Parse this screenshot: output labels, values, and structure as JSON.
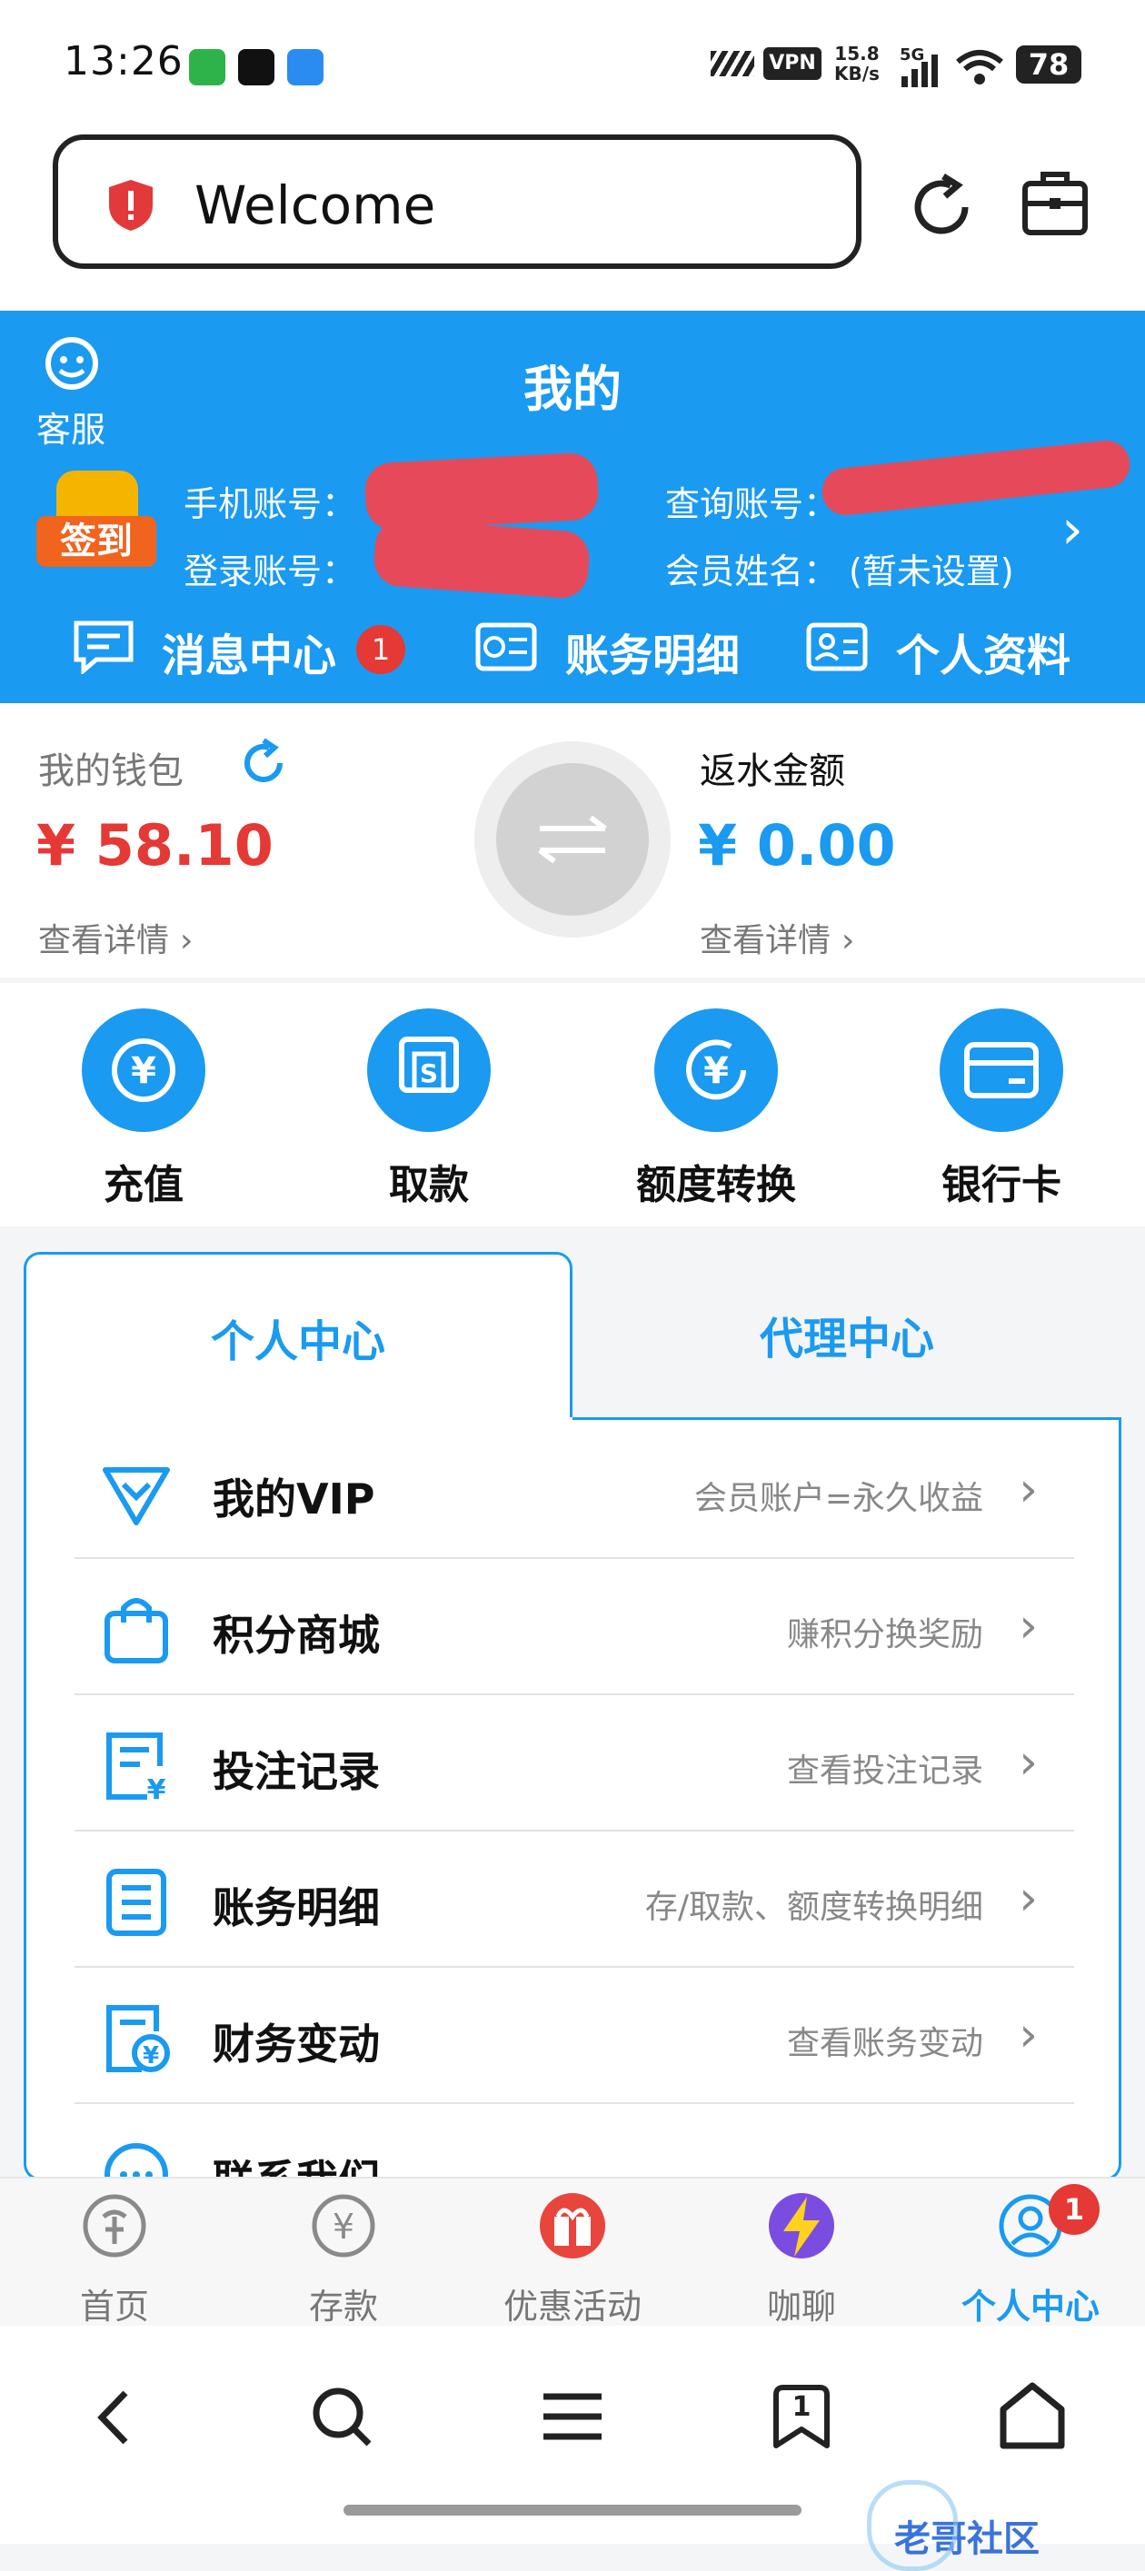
{
  "status_bar": {
    "time": "13:26",
    "vpn": "VPN",
    "speed_value": "15.8",
    "speed_unit": "KB/s",
    "network": "5G",
    "battery": "78"
  },
  "browser": {
    "url_text": "Welcome"
  },
  "header": {
    "title": "我的",
    "service_label": "客服",
    "signin_label": "签到",
    "phone_label": "手机账号：",
    "login_label": "登录账号：",
    "query_label": "查询账号：",
    "member_label": "会员姓名：",
    "member_value": "(暂未设置)",
    "quicklinks": [
      {
        "label": "消息中心",
        "badge": "1"
      },
      {
        "label": "账务明细"
      },
      {
        "label": "个人资料"
      }
    ]
  },
  "wallet": {
    "left_label": "我的钱包",
    "left_amount": "¥ 58.10",
    "right_label": "返水金额",
    "right_amount": "¥ 0.00",
    "detail_label": "查看详情",
    "chev": "›"
  },
  "actions": [
    {
      "label": "充值"
    },
    {
      "label": "取款"
    },
    {
      "label": "额度转换"
    },
    {
      "label": "银行卡"
    }
  ],
  "tabs": {
    "personal": "个人中心",
    "agent": "代理中心"
  },
  "menu": [
    {
      "title": "我的VIP",
      "sub": "会员账户=永久收益"
    },
    {
      "title": "积分商城",
      "sub": "赚积分换奖励"
    },
    {
      "title": "投注记录",
      "sub": "查看投注记录"
    },
    {
      "title": "账务明细",
      "sub": "存/取款、额度转换明细"
    },
    {
      "title": "财务变动",
      "sub": "查看账务变动"
    },
    {
      "title": "联系我们",
      "sub": ""
    }
  ],
  "menu_chev": "›",
  "tabbar": [
    {
      "label": "首页"
    },
    {
      "label": "存款"
    },
    {
      "label": "优惠活动"
    },
    {
      "label": "咖聊"
    },
    {
      "label": "个人中心",
      "badge": "1"
    }
  ],
  "browser_nav": {
    "tab_count": "1"
  },
  "watermark": "老哥社区",
  "colors": {
    "accent": "#1a9af0",
    "amount_red": "#e53935",
    "badge_red": "#e53935"
  }
}
